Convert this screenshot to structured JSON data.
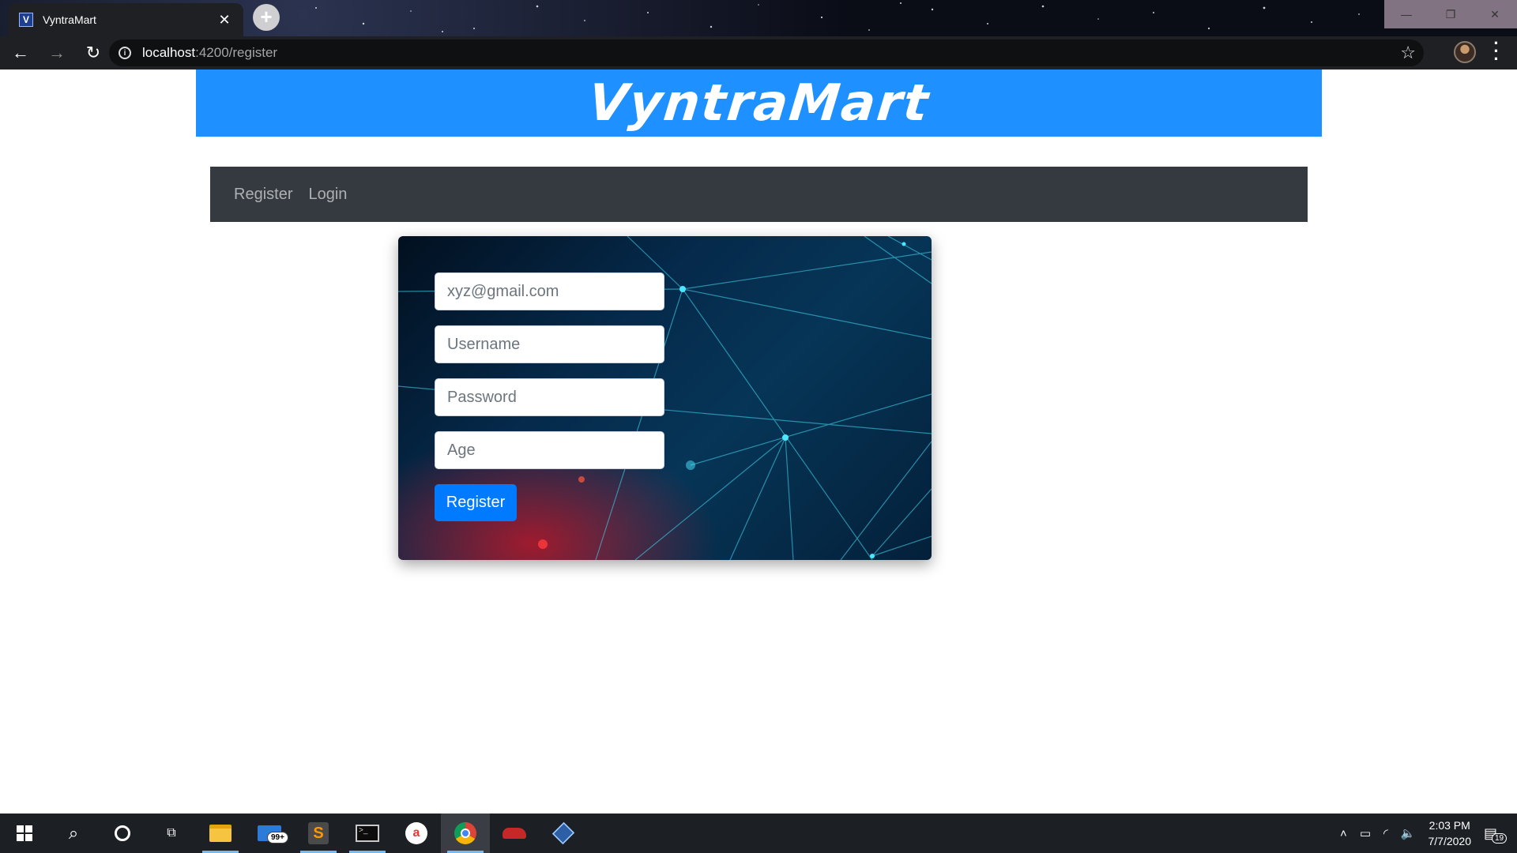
{
  "browser": {
    "tab_title": "VyntraMart",
    "tab_favicon_letter": "V",
    "url_host": "localhost",
    "url_rest": ":4200/register"
  },
  "page": {
    "brand_title": "VyntraMart",
    "nav_links": [
      "Register",
      "Login"
    ],
    "form": {
      "email_placeholder": "xyz@gmail.com",
      "username_placeholder": "Username",
      "password_placeholder": "Password",
      "age_placeholder": "Age",
      "submit_label": "Register"
    },
    "colors": {
      "banner": "#1e90ff",
      "navbar": "#343a40",
      "button": "#007bff"
    }
  },
  "taskbar": {
    "mail_badge": "99+",
    "time": "2:03 PM",
    "date": "7/7/2020",
    "notification_count": "19"
  }
}
